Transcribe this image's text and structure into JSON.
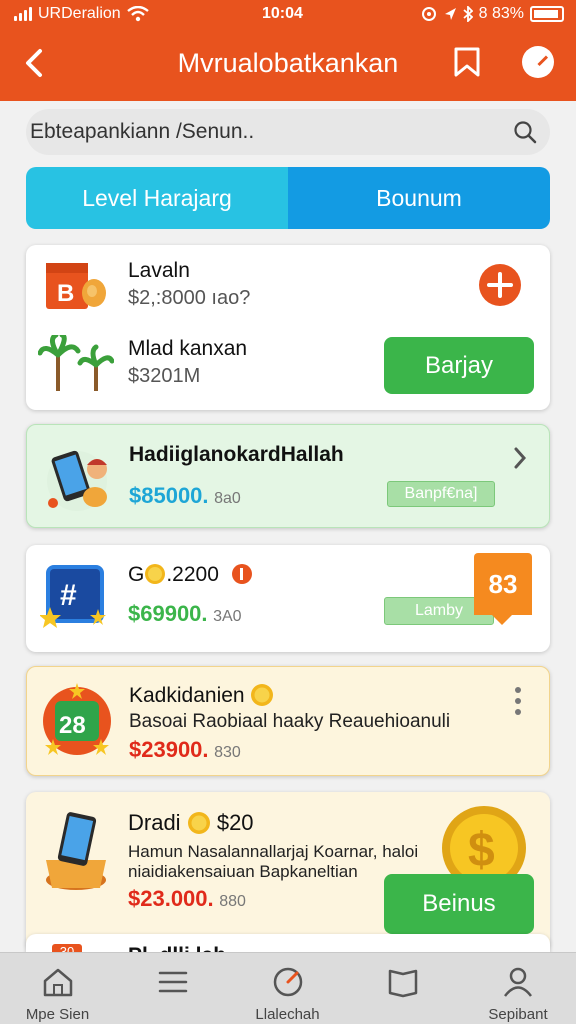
{
  "status": {
    "carrier": "URDeralion",
    "time": "10:04",
    "battery": "8 83%"
  },
  "header": {
    "title": "Mvrualobatkankan"
  },
  "search": {
    "text": "Ebteapankiann /Senun.."
  },
  "segments": [
    {
      "label": "Level Harajarg"
    },
    {
      "label": "Bounum"
    }
  ],
  "card1": {
    "item1": {
      "title": "Lavaln",
      "price": "$2,:8000 ıao?"
    },
    "item2": {
      "title": "Mlad kanxan",
      "price": "$3201M"
    },
    "button": "Barjay"
  },
  "card2": {
    "title": "HadiiglanokardHallah",
    "price": "$85000.",
    "price_suffix": "8a0",
    "button": "Banpf€na]"
  },
  "card3": {
    "title": "G",
    "title_amount": ".2200",
    "price": "$69900.",
    "price_suffix": "3A0",
    "badge": "83",
    "button": "Lamby"
  },
  "card4": {
    "title": "Kadkidanien",
    "subtitle": "Basoai Raobiaal haaky Reauehioanuli",
    "price": "$23900.",
    "price_suffix": "830",
    "badge": "28"
  },
  "card5": {
    "title": "Dradi",
    "title_amount": "$20",
    "desc1": "Hamun Nasalannallarjaj Koarnar, haloi",
    "desc2": "niaidiakensaiuan Bapkaneltian",
    "price": "$23.000.",
    "price_suffix": "880",
    "button": "Beinus"
  },
  "card6": {
    "title": "Pl..dlli.lah",
    "badge": "30"
  },
  "tabs": [
    {
      "label": "Mpe Sien",
      "icon": "home-icon"
    },
    {
      "label": "",
      "icon": "menu-icon"
    },
    {
      "label": "Llalechah",
      "icon": "gauge-icon"
    },
    {
      "label": "",
      "icon": "book-icon"
    },
    {
      "label": "Sepibant",
      "icon": "user-icon"
    }
  ],
  "colors": {
    "brand": "#e8531e",
    "accent_green": "#3bb54a",
    "segment_left": "#28c2e3",
    "segment_right": "#139be3"
  }
}
